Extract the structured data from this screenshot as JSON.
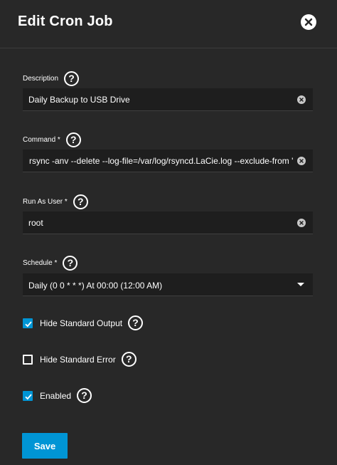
{
  "dialog": {
    "title": "Edit Cron Job",
    "close_icon": "close-circle-icon"
  },
  "fields": {
    "description": {
      "label": "Description",
      "value": "Daily Backup to USB Drive",
      "help_icon": "help-circle-icon"
    },
    "command": {
      "label": "Command *",
      "value": "rsync -anv --delete  --log-file=/var/log/rsyncd.LaCie.log --exclude-from '",
      "help_icon": "help-circle-icon"
    },
    "run_as_user": {
      "label": "Run As User *",
      "value": "root",
      "help_icon": "help-circle-icon"
    },
    "schedule": {
      "label": "Schedule *",
      "value": "Daily (0 0 * * *)  At 00:00 (12:00 AM)",
      "help_icon": "help-circle-icon"
    }
  },
  "checkboxes": [
    {
      "label": "Hide Standard Output",
      "checked": true
    },
    {
      "label": "Hide Standard Error",
      "checked": false
    },
    {
      "label": "Enabled",
      "checked": true
    }
  ],
  "help_glyph": "?",
  "save_label": "Save",
  "colors": {
    "background": "#282828",
    "input_bg": "#1e1e1e",
    "accent": "#0095d5",
    "text": "#ffffff"
  }
}
